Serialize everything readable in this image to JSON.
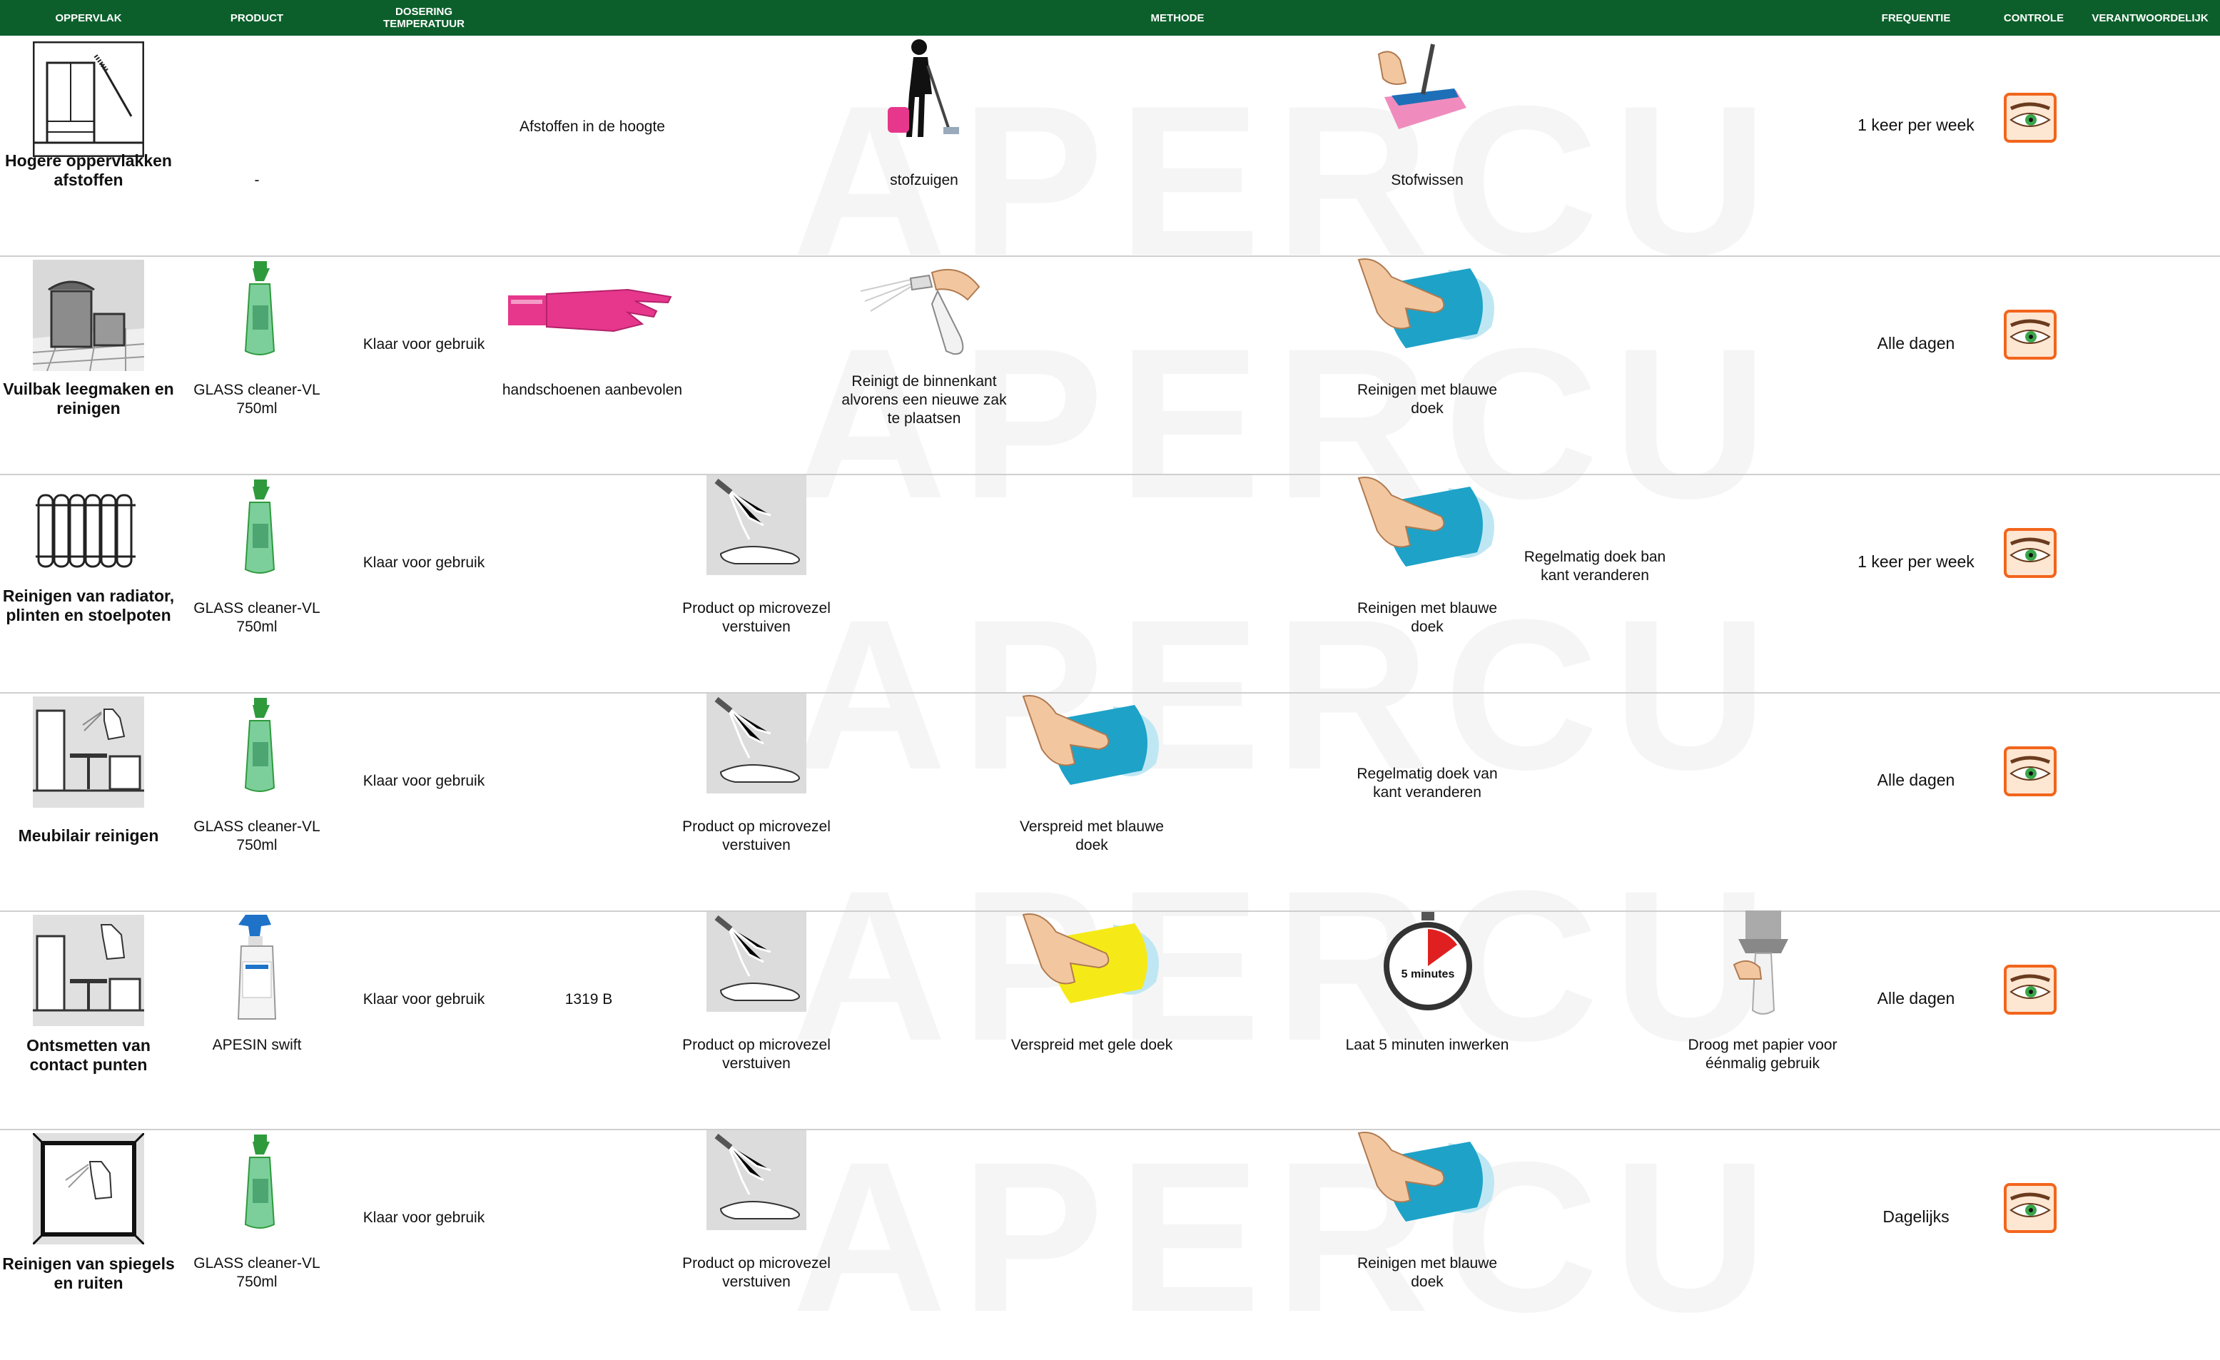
{
  "header": {
    "oppervlak": "OPPERVLAK",
    "product": "PRODUCT",
    "dosering_line1": "DOSERING",
    "dosering_line2": "TEMPERATUUR",
    "methode": "METHODE",
    "frequentie": "FREQUENTIE",
    "controle": "CONTROLE",
    "verantwoordelijk": "VERANTWOORDELIJK"
  },
  "colors": {
    "header_bg": "#0c5f2b",
    "header_text": "#ffffff",
    "eye_border": "#f2651c",
    "cloth_blue": "#1ea2c8",
    "cloth_yellow": "#f5ea17",
    "glove_pink": "#e6378c"
  },
  "rows": [
    {
      "surface": "Hogere oppervlakken afstoffen",
      "product": "-",
      "dosing": "Afstoffen in de hoogte",
      "methods": [
        {
          "icon": "vacuum-icon",
          "label": "stofzuigen"
        },
        {
          "icon": "flat-mop-icon",
          "label": "Stofwissen"
        }
      ],
      "frequency": "1 keer per week"
    },
    {
      "surface": "Vuilbak leegmaken en reinigen",
      "product": "GLASS cleaner-VL 750ml",
      "dosing": "Klaar voor gebruik",
      "methods": [
        {
          "icon": "glove-icon",
          "label": "handschoenen aanbevolen"
        },
        {
          "icon": "spray-bottle-icon",
          "label": "Reinigt de binnenkant alvorens een nieuwe zak te plaatsen"
        },
        {
          "icon": "blue-cloth-icon",
          "label": "Reinigen met blauwe doek"
        }
      ],
      "frequency": "Alle dagen"
    },
    {
      "surface": "Reinigen van radiator, plinten en stoelpoten",
      "product": "GLASS cleaner-VL 750ml",
      "dosing": "Klaar voor gebruik",
      "methods": [
        {
          "icon": "spray-hand-icon",
          "label": "Product op microvezel verstuiven"
        },
        {
          "icon": "blue-cloth-icon",
          "label": "Reinigen met blauwe doek"
        },
        {
          "icon": "",
          "label": "Regelmatig doek ban kant veranderen"
        }
      ],
      "frequency": "1 keer per week"
    },
    {
      "surface": "Meubilair reinigen",
      "product": "GLASS cleaner-VL 750ml",
      "dosing": "Klaar voor gebruik",
      "methods": [
        {
          "icon": "spray-hand-icon",
          "label": "Product op  microvezel verstuiven"
        },
        {
          "icon": "blue-cloth-icon",
          "label": "Verspreid met blauwe doek"
        },
        {
          "icon": "",
          "label": "Regelmatig doek van kant veranderen"
        }
      ],
      "frequency": "Alle dagen"
    },
    {
      "surface": "Ontsmetten van contact punten",
      "product": "APESIN swift",
      "dosing": "Klaar voor gebruik",
      "dosing_code": "1319 B",
      "methods": [
        {
          "icon": "spray-hand-icon",
          "label": "Product op  microvezel verstuiven"
        },
        {
          "icon": "yellow-cloth-icon",
          "label": "Verspreid met gele doek"
        },
        {
          "icon": "stopwatch-icon",
          "label": "Laat 5 minuten inwerken",
          "icon_text": "5 minutes"
        },
        {
          "icon": "paper-dispenser-icon",
          "label": "Droog met papier voor éénmalig gebruik"
        }
      ],
      "frequency": "Alle dagen"
    },
    {
      "surface": "Reinigen van spiegels en ruiten",
      "product": "GLASS cleaner-VL 750ml",
      "dosing": "Klaar voor gebruik",
      "methods": [
        {
          "icon": "spray-hand-icon",
          "label": "Product op  microvezel verstuiven"
        },
        {
          "icon": "blue-cloth-icon",
          "label": "Reinigen met blauwe doek"
        }
      ],
      "frequency": "Dagelijks"
    }
  ]
}
